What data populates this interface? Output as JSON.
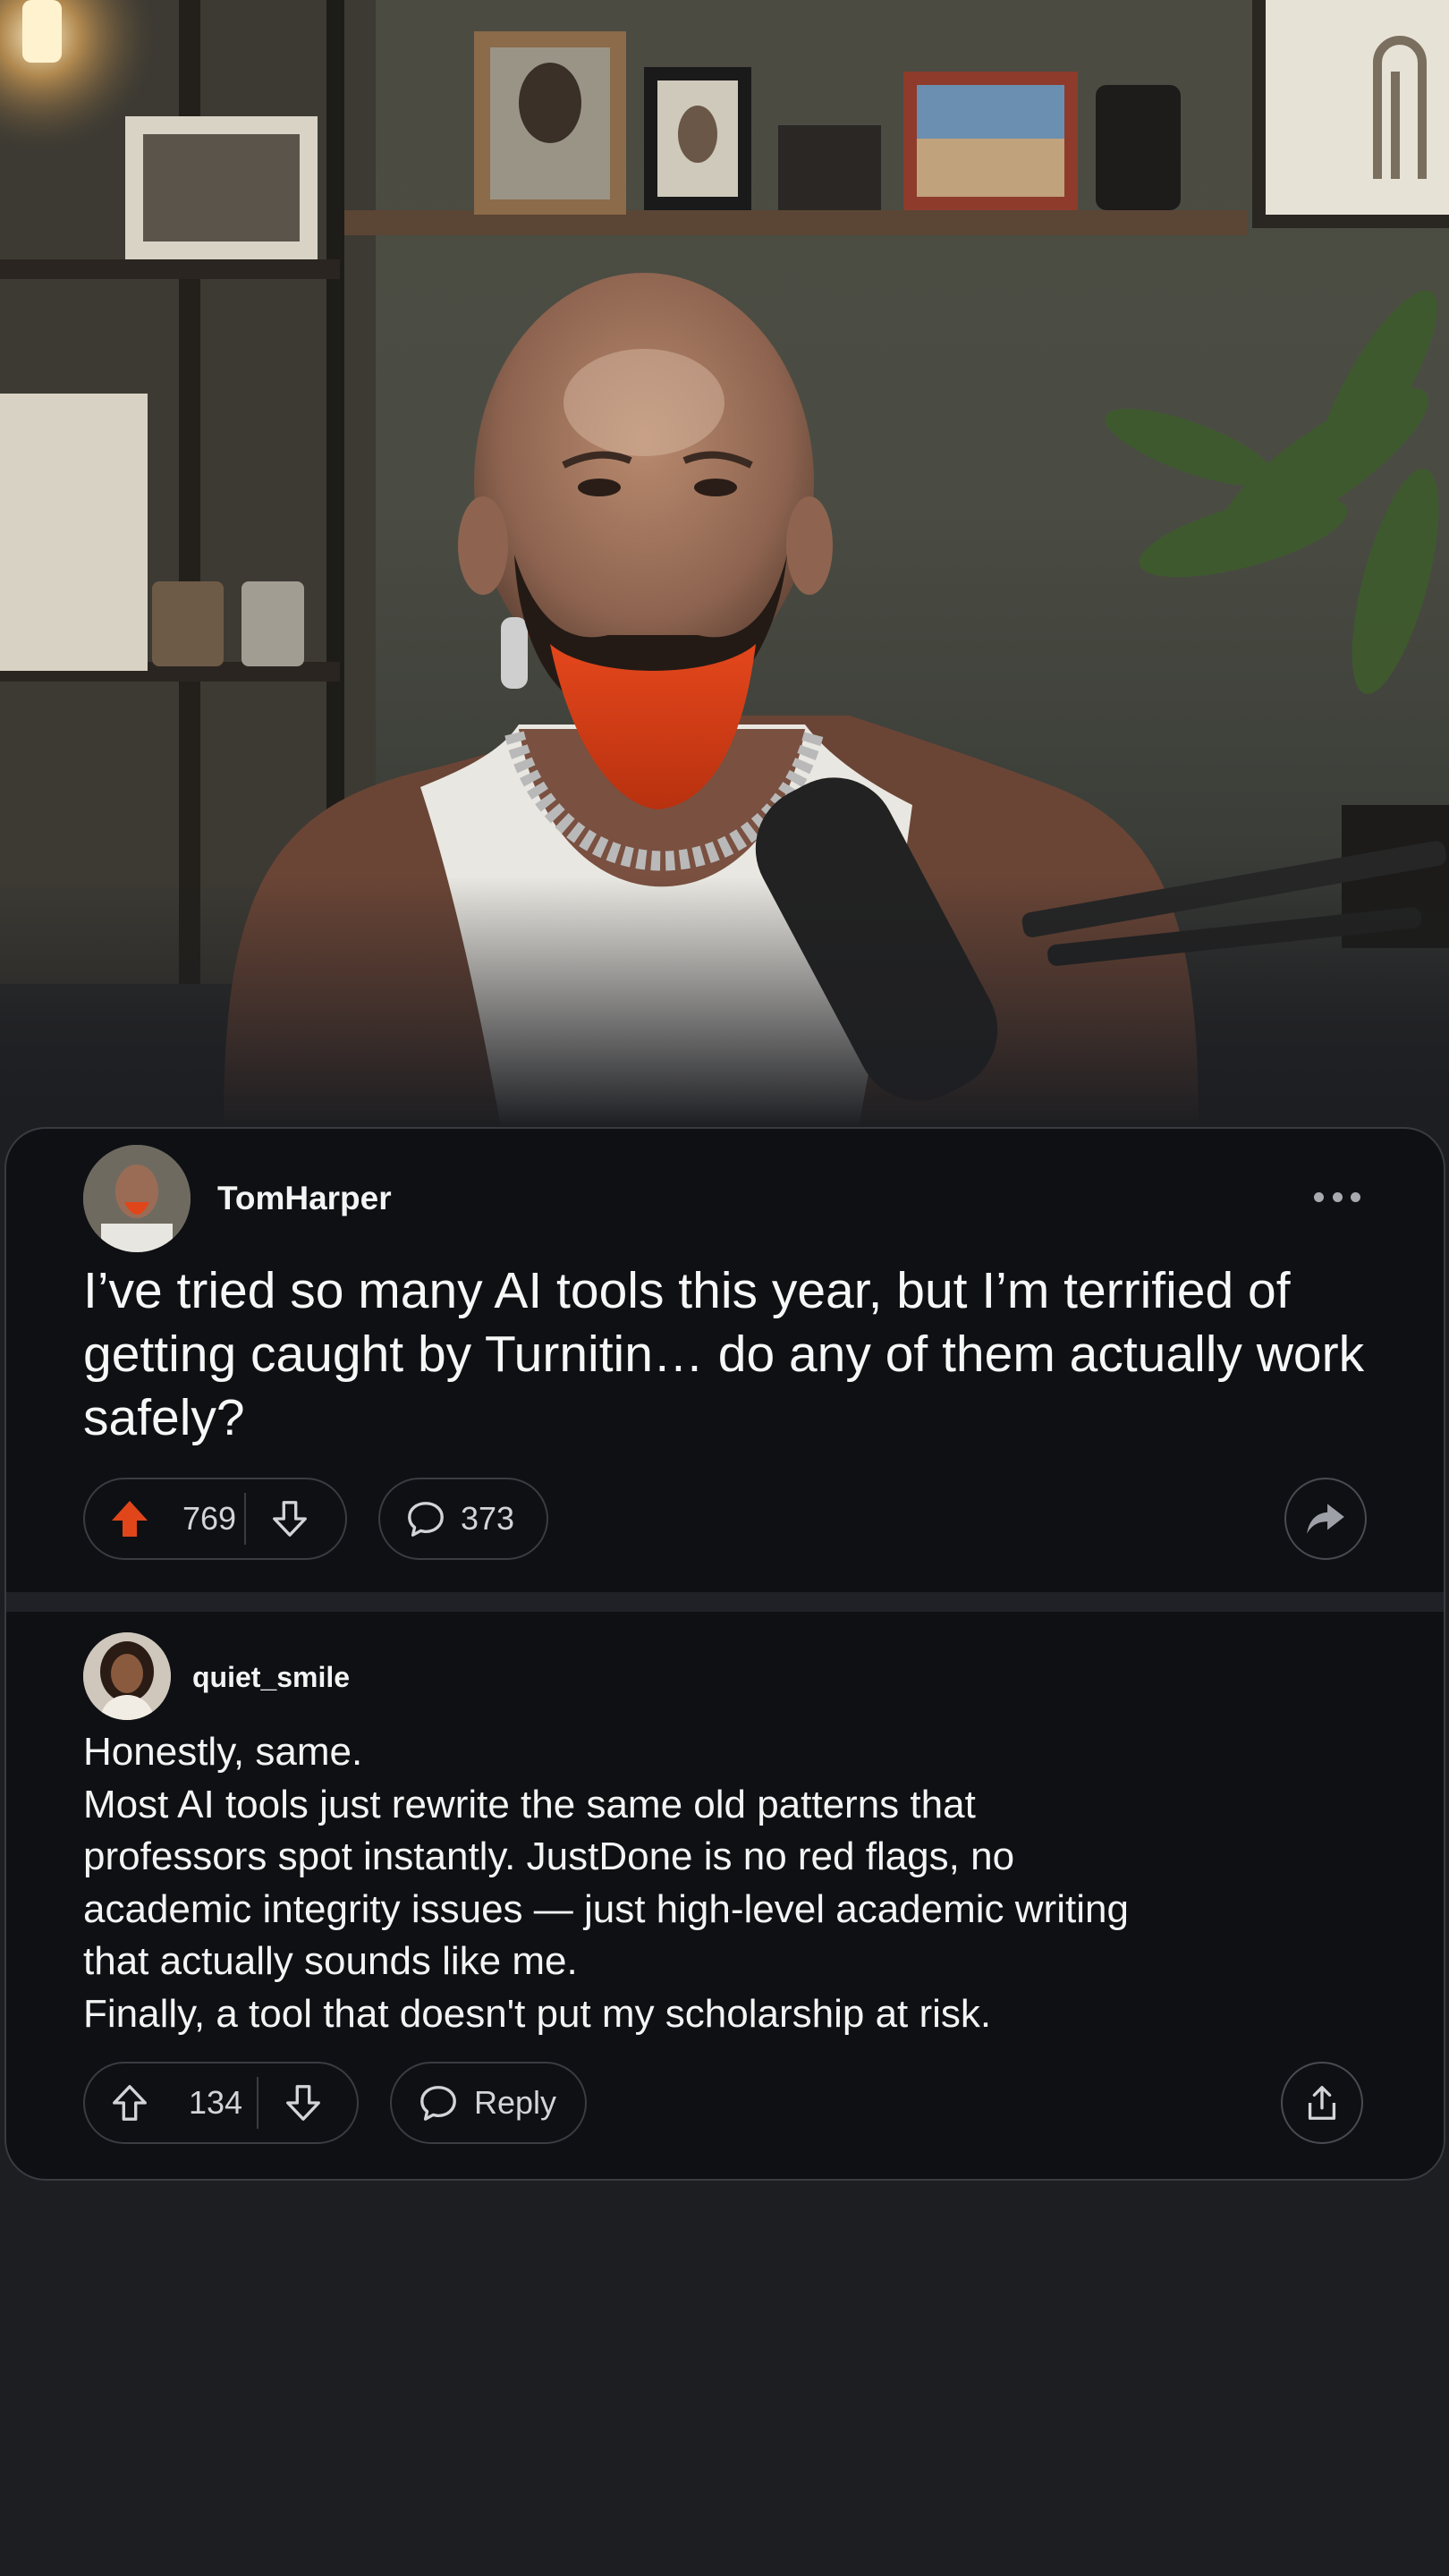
{
  "post": {
    "author": "TomHarper",
    "title": "I’ve tried so many AI tools this year, but I’m terrified of getting caught by Turnitin… do any of them actually work safely?",
    "upvotes": "769",
    "comments": "373",
    "upvote_active_color": "#e0461a"
  },
  "comment": {
    "author": "quiet_smile",
    "lines": [
      "Honestly, same.",
      "Most AI tools just rewrite the same old patterns that",
      "professors spot instantly. JustDone is no red flags, no",
      "academic integrity issues — just high-level academic writing",
      "that actually sounds like me.",
      "Finally, a tool that doesn't put my scholarship at risk."
    ],
    "upvotes": "134",
    "reply_label": "Reply"
  },
  "icons": {
    "more": "more-horizontal-icon",
    "upvote": "arrow-up-icon",
    "downvote": "arrow-down-icon",
    "comment": "speech-bubble-icon",
    "share": "share-arrow-icon",
    "export": "share-upload-icon"
  }
}
